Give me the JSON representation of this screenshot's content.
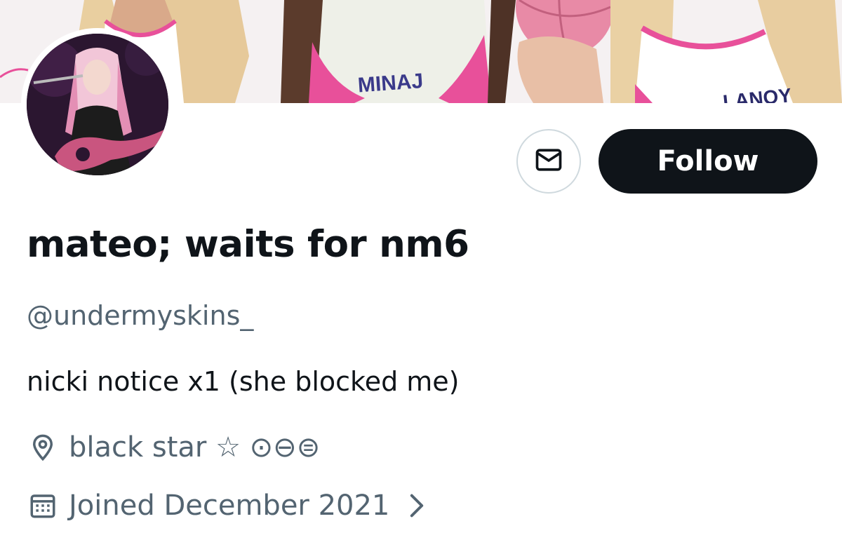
{
  "banner": {
    "jersey_text_center": "MINAJ",
    "jersey_text_right": "LANOY"
  },
  "profile": {
    "display_name": "mateo; waits for nm6",
    "handle": "@undermyskins_",
    "bio": "nicki notice x1 (she blocked me)",
    "location": "black star ☆ ⊙⊖⊜",
    "joined": "Joined December 2021"
  },
  "actions": {
    "follow_label": "Follow"
  },
  "icons": {
    "message": "envelope-icon",
    "location": "map-pin-icon",
    "joined": "calendar-icon",
    "chevron": "chevron-right-icon"
  },
  "colors": {
    "text_primary": "#0f1419",
    "text_secondary": "#536471",
    "follow_bg": "#0f1419",
    "accent_pink": "#e8509a"
  }
}
